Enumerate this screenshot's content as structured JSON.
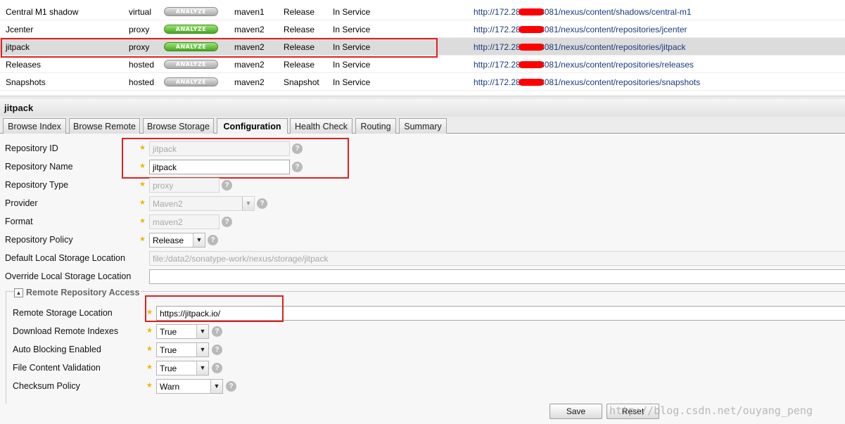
{
  "repositories": [
    {
      "name": "Central M1 shadow",
      "type": "virtual",
      "analyze": "ANALYZE",
      "analyze_on": false,
      "format": "maven1",
      "policy": "Release",
      "status": "In Service",
      "url_start": "http://172.28.",
      "url_end": "8081/nexus/content/shadows/central-m1"
    },
    {
      "name": "Jcenter",
      "type": "proxy",
      "analyze": "ANALYZE",
      "analyze_on": true,
      "format": "maven2",
      "policy": "Release",
      "status": "In Service",
      "url_start": "http://172.28.",
      "url_end": "8081/nexus/content/repositories/jcenter"
    },
    {
      "name": "jitpack",
      "type": "proxy",
      "analyze": "ANALYZE",
      "analyze_on": true,
      "format": "maven2",
      "policy": "Release",
      "status": "In Service",
      "url_start": "http://172.28.",
      "url_end": "8081/nexus/content/repositories/jitpack",
      "selected": true
    },
    {
      "name": "Releases",
      "type": "hosted",
      "analyze": "ANALYZE",
      "analyze_on": false,
      "format": "maven2",
      "policy": "Release",
      "status": "In Service",
      "url_start": "http://172.28.",
      "url_end": "8081/nexus/content/repositories/releases"
    },
    {
      "name": "Snapshots",
      "type": "hosted",
      "analyze": "ANALYZE",
      "analyze_on": false,
      "format": "maven2",
      "policy": "Snapshot",
      "status": "In Service",
      "url_start": "http://172.28.",
      "url_end": "8081/nexus/content/repositories/snapshots"
    }
  ],
  "detail": {
    "title": "jitpack",
    "tabs": [
      {
        "label": "Browse Index"
      },
      {
        "label": "Browse Remote"
      },
      {
        "label": "Browse Storage"
      },
      {
        "label": "Configuration",
        "active": true
      },
      {
        "label": "Health Check"
      },
      {
        "label": "Routing"
      },
      {
        "label": "Summary"
      }
    ]
  },
  "form": {
    "repo_id": {
      "label": "Repository ID",
      "value": "jitpack"
    },
    "repo_name": {
      "label": "Repository Name",
      "value": "jitpack"
    },
    "repo_type": {
      "label": "Repository Type",
      "value": "proxy"
    },
    "provider": {
      "label": "Provider",
      "value": "Maven2"
    },
    "format": {
      "label": "Format",
      "value": "maven2"
    },
    "repo_policy": {
      "label": "Repository Policy",
      "value": "Release"
    },
    "default_storage": {
      "label": "Default Local Storage Location",
      "value": "file:/data2/sonatype-work/nexus/storage/jitpack"
    },
    "override_storage": {
      "label": "Override Local Storage Location",
      "value": ""
    },
    "remote_section": {
      "title": "Remote Repository Access"
    },
    "remote_location": {
      "label": "Remote Storage Location",
      "value": "https://jitpack.io/"
    },
    "download_indexes": {
      "label": "Download Remote Indexes",
      "value": "True"
    },
    "auto_blocking": {
      "label": "Auto Blocking Enabled",
      "value": "True"
    },
    "file_validation": {
      "label": "File Content Validation",
      "value": "True"
    },
    "checksum_policy": {
      "label": "Checksum Policy",
      "value": "Warn"
    }
  },
  "buttons": {
    "save": "Save",
    "reset": "Reset"
  },
  "watermark": "http://blog.csdn.net/ouyang_peng",
  "colors": {
    "highlight": "#e02020",
    "star": "#f0b400",
    "analyze_on": "#46a81d",
    "link": "#1a3a7a"
  }
}
